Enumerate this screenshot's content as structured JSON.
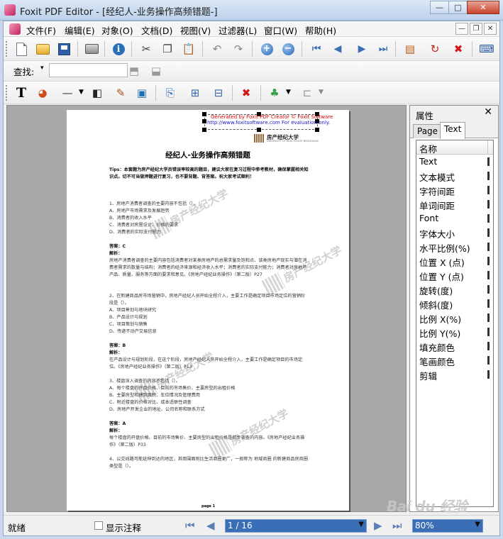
{
  "window": {
    "title": "Foxit PDF Editor - [经纪人-业务操作高频错题-]",
    "min": "—",
    "max": "□",
    "close": "✕"
  },
  "menu": {
    "items": [
      "文件(F)",
      "编辑(E)",
      "对象(O)",
      "文档(D)",
      "视图(V)",
      "过滤器(L)",
      "窗口(W)",
      "帮助(H)"
    ],
    "mdi_min": "—",
    "mdi_restore": "❐",
    "mdi_close": "✕"
  },
  "find": {
    "label": "查找:",
    "value": ""
  },
  "document": {
    "eval_line1": "Generated by Foxit PDF Creator © Foxit Software",
    "eval_line2": "http://www.foxitsoftware.com   For evaluation only.",
    "logo_text": "房产经纪大学",
    "logo_sub": "UNIVERSITY OF REAL ESTATE BROKERAGE",
    "title": "经纪人-业务操作高频错题",
    "tips": "Tips：本套题为房产经纪大学员错误率较高的题目，建议大家在复习过程中参考教材，确保掌握相关知识点。切不可当做押题进行复习，也不要背题、背答案。祝大家考试顺利！",
    "q1": "1、房地产消费者调查的主要内容不包括（）。",
    "q1a": "A、房地产市场需求及发展趋势",
    "q1b": "B、消费者的收入水平",
    "q1c": "C、消费者对房屋设计、价格的要求",
    "q1d": "D、消费者的实际支付能力",
    "ans1": "答案：C",
    "exp_label": "解析：",
    "exp1": "房地产消费者调查的主要内容包括消费者对某类房地产的总需求量及饱和点、该类房地产现实与潜在消费者需求的数量与结构；消费者的经济来源和经济收入水平；消费者的实际支付能力；消费者对房地产产品、质量、服务等方面的要求和意见。《房地产经纪业务操作》（第二版）P27",
    "q2": "2、在新建商品房市场营销中，房地产经纪人员开始全程介入，主要工作是确定项目市场定位的营销阶段是（）。",
    "q2a": "A、项目筹划与地块研究",
    "q2b": "B、产品设计与规划",
    "q2c": "C、项目策划与销售",
    "q2d": "D、传递不动产交易信息",
    "ans2": "答案：B",
    "exp2": "在产品设计与规划阶段，在这个阶段，房地产经纪人员开始全程介入，主要工作是确定项目的市场定位。《房地产经纪业务操作》（第二版）P13",
    "q3": "3、楼盘深入调查的内容不包括（）。",
    "q3a": "A、每个楼盘的开盘价格、目前的市场售价、主要房型的出租价格",
    "q3b": "B、主要房型和建筑面积、车位情况及管理费用",
    "q3c": "C、附近楼盘的价格对比、成本适联性调查",
    "q3d": "D、房地产开发企业的地址、公司名称和联系方式",
    "ans3": "答案：A",
    "exp3": "每个楼盘的开盘价格、目前的市场售价、主要房型的出租价格是初步调查的内容。《房地产经纪业务操作》（第二版）P33",
    "q4": "4、公交线路可能延伸到达的地区，其周围面则比生活商圈更广，一般称为 地域商圈 的新建商品房商圈类型是（）。",
    "page_num": "page 1",
    "watermark_text": "房产经纪大学"
  },
  "panel": {
    "title": "属性",
    "close": "✕",
    "tabs": [
      "Page",
      "Text"
    ],
    "header": "名称",
    "props": [
      "Text",
      "文本模式",
      "字符间距",
      "单词间距",
      "Font",
      "字体大小",
      "水平比例(%)",
      "位置 X (点)",
      "位置 Y (点)",
      "旋转(度)",
      "倾斜(度)",
      "比例 X(%)",
      "比例 Y(%)",
      "填充颜色",
      "笔画颜色",
      "剪辑"
    ]
  },
  "status": {
    "text": "就绪",
    "show_annotations": "显示注释",
    "page": "1 / 16",
    "zoom": "80%",
    "watermark": "Bai du 经验"
  }
}
